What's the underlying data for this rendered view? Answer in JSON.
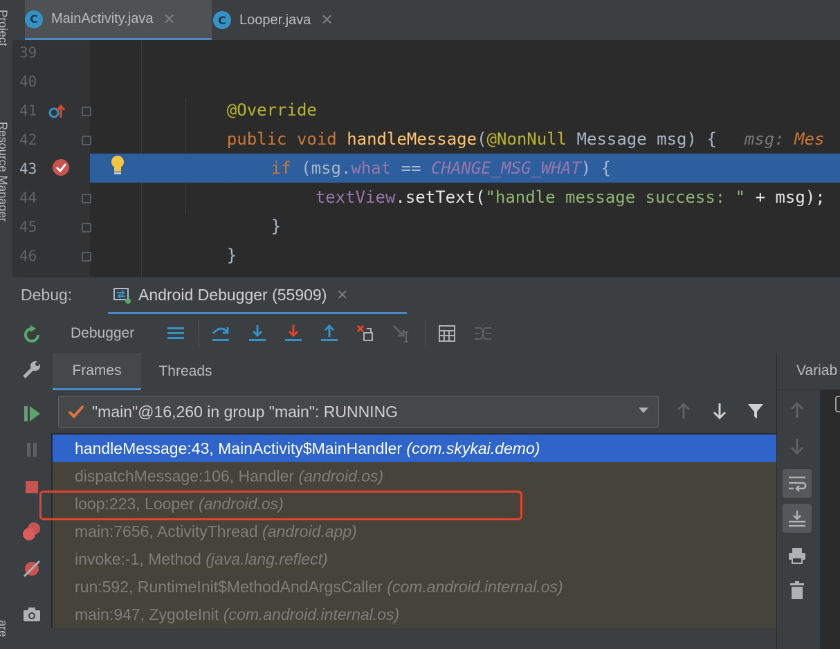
{
  "side": {
    "project_label": "Project",
    "resource_label": "Resource Manager",
    "bottom_label": "are"
  },
  "tabs": [
    {
      "label": "MainActivity.java",
      "icon": "class-c-icon"
    },
    {
      "label": "Looper.java",
      "icon": "class-c-icon"
    }
  ],
  "editor": {
    "line_numbers": [
      "39",
      "40",
      "41",
      "42",
      "43",
      "44",
      "45",
      "46"
    ],
    "lines": {
      "l40": {
        "ann": "@Override"
      },
      "l41": {
        "kw1": "public ",
        "kw2": "void ",
        "fn": "handleMessage",
        "p1": "(",
        "ann": "@NonNull",
        "p2": " Message msg) {",
        "hint": "msg: ",
        "hintv": "Mes"
      },
      "l42": {
        "kw": "if",
        "p1": " (msg.",
        "fld": "what",
        "p2": " == ",
        "const": "CHANGE_MSG_WHAT",
        "p3": ") {"
      },
      "l43": {
        "fld": "textView",
        "p1": ".setText(",
        "str": "\"handle message success: \"",
        "p2": " + msg);"
      },
      "l44": {
        "p": "}"
      },
      "l45": {
        "p": "}"
      },
      "l46": {
        "p": "}"
      }
    }
  },
  "debug": {
    "label": "Debug:",
    "session_tab": "Android Debugger (55909)",
    "toolbar_label": "Debugger",
    "tabs": {
      "frames": "Frames",
      "threads": "Threads"
    },
    "variables_label": "Variab",
    "thread_select": "\"main\"@16,260 in group \"main\": RUNNING",
    "frames": [
      {
        "method": "handleMessage:43, MainActivity$MainHandler ",
        "pkg": "(com.skykai.demo)"
      },
      {
        "method": "dispatchMessage:106, Handler ",
        "pkg": "(android.os)"
      },
      {
        "method": "loop:223, Looper ",
        "pkg": "(android.os)"
      },
      {
        "method": "main:7656, ActivityThread ",
        "pkg": "(android.app)"
      },
      {
        "method": "invoke:-1, Method ",
        "pkg": "(java.lang.reflect)"
      },
      {
        "method": "run:592, RuntimeInit$MethodAndArgsCaller ",
        "pkg": "(com.android.internal.os)"
      },
      {
        "method": "main:947, ZygoteInit ",
        "pkg": "(com.android.internal.os)"
      }
    ]
  },
  "colors": {
    "accent": "#2f65ca",
    "highlight_box": "#e0442c",
    "exec_line": "#2d5f9e"
  }
}
